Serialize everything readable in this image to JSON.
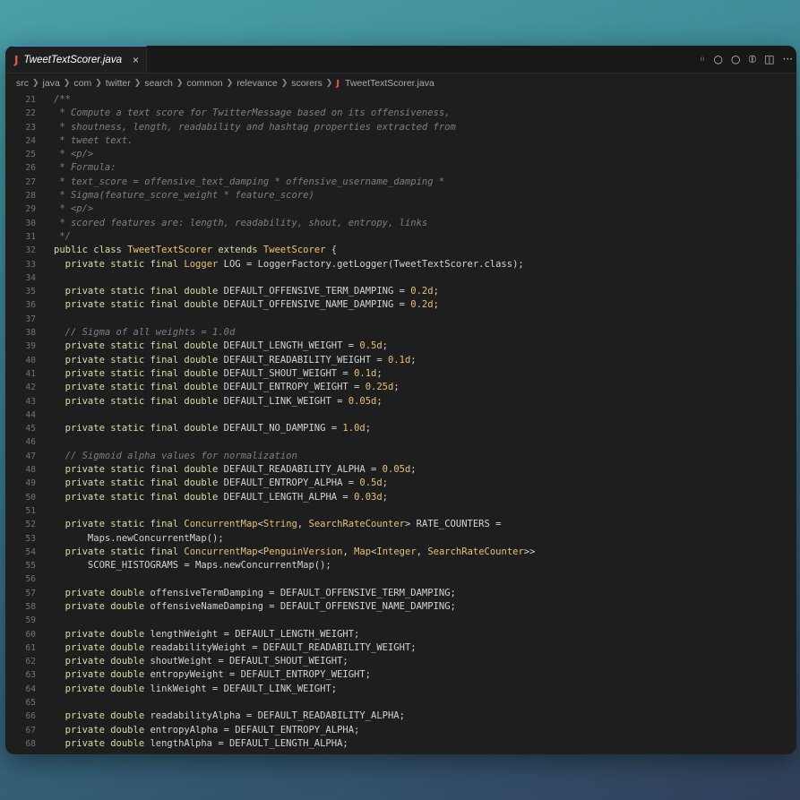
{
  "tab": {
    "label": "TweetTextScorer.java",
    "close": "×",
    "icon": "J"
  },
  "tab_actions": [
    "◦",
    "○",
    "○",
    "⦶",
    "◫",
    "···"
  ],
  "breadcrumb": [
    "src",
    "java",
    "com",
    "twitter",
    "search",
    "common",
    "relevance",
    "scorers",
    "TweetTextScorer.java"
  ],
  "colors": {
    "accent": "#3a8ee6",
    "java_icon": "#e05a4f"
  },
  "lines": [
    {
      "n": "21",
      "indent": 1,
      "tokens": [
        [
          "doc",
          "/**"
        ]
      ]
    },
    {
      "n": "22",
      "indent": 1,
      "tokens": [
        [
          "doc",
          " * Compute a text score for TwitterMessage based on its offensiveness,"
        ]
      ]
    },
    {
      "n": "23",
      "indent": 1,
      "tokens": [
        [
          "doc",
          " * shoutness, length, readability and hashtag properties extracted from"
        ]
      ]
    },
    {
      "n": "24",
      "indent": 1,
      "tokens": [
        [
          "doc",
          " * tweet text."
        ]
      ]
    },
    {
      "n": "25",
      "indent": 1,
      "tokens": [
        [
          "doc",
          " * <p/>"
        ]
      ]
    },
    {
      "n": "26",
      "indent": 1,
      "tokens": [
        [
          "doc",
          " * Formula:"
        ]
      ]
    },
    {
      "n": "27",
      "indent": 1,
      "tokens": [
        [
          "doc",
          " * text_score = offensive_text_damping * offensive_username_damping *"
        ]
      ]
    },
    {
      "n": "28",
      "indent": 1,
      "tokens": [
        [
          "doc",
          " * Sigma(feature_score_weight * feature_score)"
        ]
      ]
    },
    {
      "n": "29",
      "indent": 1,
      "tokens": [
        [
          "doc",
          " * <p/>"
        ]
      ]
    },
    {
      "n": "30",
      "indent": 1,
      "tokens": [
        [
          "doc",
          " * scored features are: length, readability, shout, entropy, links"
        ]
      ]
    },
    {
      "n": "31",
      "indent": 1,
      "tokens": [
        [
          "doc",
          " */"
        ]
      ]
    },
    {
      "n": "32",
      "indent": 0,
      "tokens": [
        [
          "kw",
          "public class "
        ],
        [
          "cls",
          "TweetTextScorer"
        ],
        [
          "kw",
          " extends "
        ],
        [
          "cls",
          "TweetScorer"
        ],
        [
          "txt",
          " {"
        ]
      ]
    },
    {
      "n": "33",
      "indent": 1,
      "tokens": [
        [
          "kw",
          "  private static final "
        ],
        [
          "ty",
          "Logger"
        ],
        [
          "txt",
          " LOG = LoggerFactory.getLogger(TweetTextScorer.class);"
        ]
      ]
    },
    {
      "n": "34",
      "indent": 1,
      "tokens": []
    },
    {
      "n": "35",
      "indent": 1,
      "tokens": [
        [
          "kw",
          "  private static final double "
        ],
        [
          "txt",
          "DEFAULT_OFFENSIVE_TERM_DAMPING = "
        ],
        [
          "num",
          "0.2d"
        ],
        [
          "txt",
          ";"
        ]
      ]
    },
    {
      "n": "36",
      "indent": 1,
      "tokens": [
        [
          "kw",
          "  private static final double "
        ],
        [
          "txt",
          "DEFAULT_OFFENSIVE_NAME_DAMPING = "
        ],
        [
          "num",
          "0.2d"
        ],
        [
          "txt",
          ";"
        ]
      ]
    },
    {
      "n": "37",
      "indent": 1,
      "tokens": []
    },
    {
      "n": "38",
      "indent": 1,
      "tokens": [
        [
          "doc",
          "  // Sigma of all weights = 1.0d"
        ]
      ]
    },
    {
      "n": "39",
      "indent": 1,
      "tokens": [
        [
          "kw",
          "  private static final double "
        ],
        [
          "txt",
          "DEFAULT_LENGTH_WEIGHT = "
        ],
        [
          "num",
          "0.5d"
        ],
        [
          "txt",
          ";"
        ]
      ]
    },
    {
      "n": "40",
      "indent": 1,
      "tokens": [
        [
          "kw",
          "  private static final double "
        ],
        [
          "txt",
          "DEFAULT_READABILITY_WEIGHT = "
        ],
        [
          "num",
          "0.1d"
        ],
        [
          "txt",
          ";"
        ]
      ]
    },
    {
      "n": "41",
      "indent": 1,
      "tokens": [
        [
          "kw",
          "  private static final double "
        ],
        [
          "txt",
          "DEFAULT_SHOUT_WEIGHT = "
        ],
        [
          "num",
          "0.1d"
        ],
        [
          "txt",
          ";"
        ]
      ]
    },
    {
      "n": "42",
      "indent": 1,
      "tokens": [
        [
          "kw",
          "  private static final double "
        ],
        [
          "txt",
          "DEFAULT_ENTROPY_WEIGHT = "
        ],
        [
          "num",
          "0.25d"
        ],
        [
          "txt",
          ";"
        ]
      ]
    },
    {
      "n": "43",
      "indent": 1,
      "tokens": [
        [
          "kw",
          "  private static final double "
        ],
        [
          "txt",
          "DEFAULT_LINK_WEIGHT = "
        ],
        [
          "num",
          "0.05d"
        ],
        [
          "txt",
          ";"
        ]
      ]
    },
    {
      "n": "44",
      "indent": 1,
      "tokens": []
    },
    {
      "n": "45",
      "indent": 1,
      "tokens": [
        [
          "kw",
          "  private static final double "
        ],
        [
          "txt",
          "DEFAULT_NO_DAMPING = "
        ],
        [
          "num",
          "1.0d"
        ],
        [
          "txt",
          ";"
        ]
      ]
    },
    {
      "n": "46",
      "indent": 1,
      "tokens": []
    },
    {
      "n": "47",
      "indent": 1,
      "tokens": [
        [
          "doc",
          "  // Sigmoid alpha values for normalization"
        ]
      ]
    },
    {
      "n": "48",
      "indent": 1,
      "tokens": [
        [
          "kw",
          "  private static final double "
        ],
        [
          "txt",
          "DEFAULT_READABILITY_ALPHA = "
        ],
        [
          "num",
          "0.05d"
        ],
        [
          "txt",
          ";"
        ]
      ]
    },
    {
      "n": "49",
      "indent": 1,
      "tokens": [
        [
          "kw",
          "  private static final double "
        ],
        [
          "txt",
          "DEFAULT_ENTROPY_ALPHA = "
        ],
        [
          "num",
          "0.5d"
        ],
        [
          "txt",
          ";"
        ]
      ]
    },
    {
      "n": "50",
      "indent": 1,
      "tokens": [
        [
          "kw",
          "  private static final double "
        ],
        [
          "txt",
          "DEFAULT_LENGTH_ALPHA = "
        ],
        [
          "num",
          "0.03d"
        ],
        [
          "txt",
          ";"
        ]
      ]
    },
    {
      "n": "51",
      "indent": 1,
      "tokens": []
    },
    {
      "n": "52",
      "indent": 1,
      "tokens": [
        [
          "kw",
          "  private static final "
        ],
        [
          "ty",
          "ConcurrentMap"
        ],
        [
          "txt",
          "<"
        ],
        [
          "ty",
          "String"
        ],
        [
          "txt",
          ", "
        ],
        [
          "ty",
          "SearchRateCounter"
        ],
        [
          "txt",
          "> RATE_COUNTERS ="
        ]
      ]
    },
    {
      "n": "53",
      "indent": 2,
      "tokens": [
        [
          "txt",
          "      Maps.newConcurrentMap();"
        ]
      ]
    },
    {
      "n": "54",
      "indent": 1,
      "tokens": [
        [
          "kw",
          "  private static final "
        ],
        [
          "ty",
          "ConcurrentMap"
        ],
        [
          "txt",
          "<"
        ],
        [
          "ty",
          "PenguinVersion"
        ],
        [
          "txt",
          ", "
        ],
        [
          "ty",
          "Map"
        ],
        [
          "txt",
          "<"
        ],
        [
          "ty",
          "Integer"
        ],
        [
          "txt",
          ", "
        ],
        [
          "ty",
          "SearchRateCounter"
        ],
        [
          "txt",
          ">>"
        ]
      ]
    },
    {
      "n": "55",
      "indent": 2,
      "tokens": [
        [
          "txt",
          "      SCORE_HISTOGRAMS = Maps.newConcurrentMap();"
        ]
      ]
    },
    {
      "n": "56",
      "indent": 1,
      "tokens": []
    },
    {
      "n": "57",
      "indent": 1,
      "tokens": [
        [
          "kw",
          "  private double "
        ],
        [
          "txt",
          "offensiveTermDamping = DEFAULT_OFFENSIVE_TERM_DAMPING;"
        ]
      ]
    },
    {
      "n": "58",
      "indent": 1,
      "tokens": [
        [
          "kw",
          "  private double "
        ],
        [
          "txt",
          "offensiveNameDamping = DEFAULT_OFFENSIVE_NAME_DAMPING;"
        ]
      ]
    },
    {
      "n": "59",
      "indent": 1,
      "tokens": []
    },
    {
      "n": "60",
      "indent": 1,
      "tokens": [
        [
          "kw",
          "  private double "
        ],
        [
          "txt",
          "lengthWeight = DEFAULT_LENGTH_WEIGHT;"
        ]
      ]
    },
    {
      "n": "61",
      "indent": 1,
      "tokens": [
        [
          "kw",
          "  private double "
        ],
        [
          "txt",
          "readabilityWeight = DEFAULT_READABILITY_WEIGHT;"
        ]
      ]
    },
    {
      "n": "62",
      "indent": 1,
      "tokens": [
        [
          "kw",
          "  private double "
        ],
        [
          "txt",
          "shoutWeight = DEFAULT_SHOUT_WEIGHT;"
        ]
      ]
    },
    {
      "n": "63",
      "indent": 1,
      "tokens": [
        [
          "kw",
          "  private double "
        ],
        [
          "txt",
          "entropyWeight = DEFAULT_ENTROPY_WEIGHT;"
        ]
      ]
    },
    {
      "n": "64",
      "indent": 1,
      "tokens": [
        [
          "kw",
          "  private double "
        ],
        [
          "txt",
          "linkWeight = DEFAULT_LINK_WEIGHT;"
        ]
      ]
    },
    {
      "n": "65",
      "indent": 1,
      "tokens": []
    },
    {
      "n": "66",
      "indent": 1,
      "tokens": [
        [
          "kw",
          "  private double "
        ],
        [
          "txt",
          "readabilityAlpha = DEFAULT_READABILITY_ALPHA;"
        ]
      ]
    },
    {
      "n": "67",
      "indent": 1,
      "tokens": [
        [
          "kw",
          "  private double "
        ],
        [
          "txt",
          "entropyAlpha = DEFAULT_ENTROPY_ALPHA;"
        ]
      ]
    },
    {
      "n": "68",
      "indent": 1,
      "tokens": [
        [
          "kw",
          "  private double "
        ],
        [
          "txt",
          "lengthAlpha = DEFAULT_LENGTH_ALPHA;"
        ]
      ]
    }
  ]
}
